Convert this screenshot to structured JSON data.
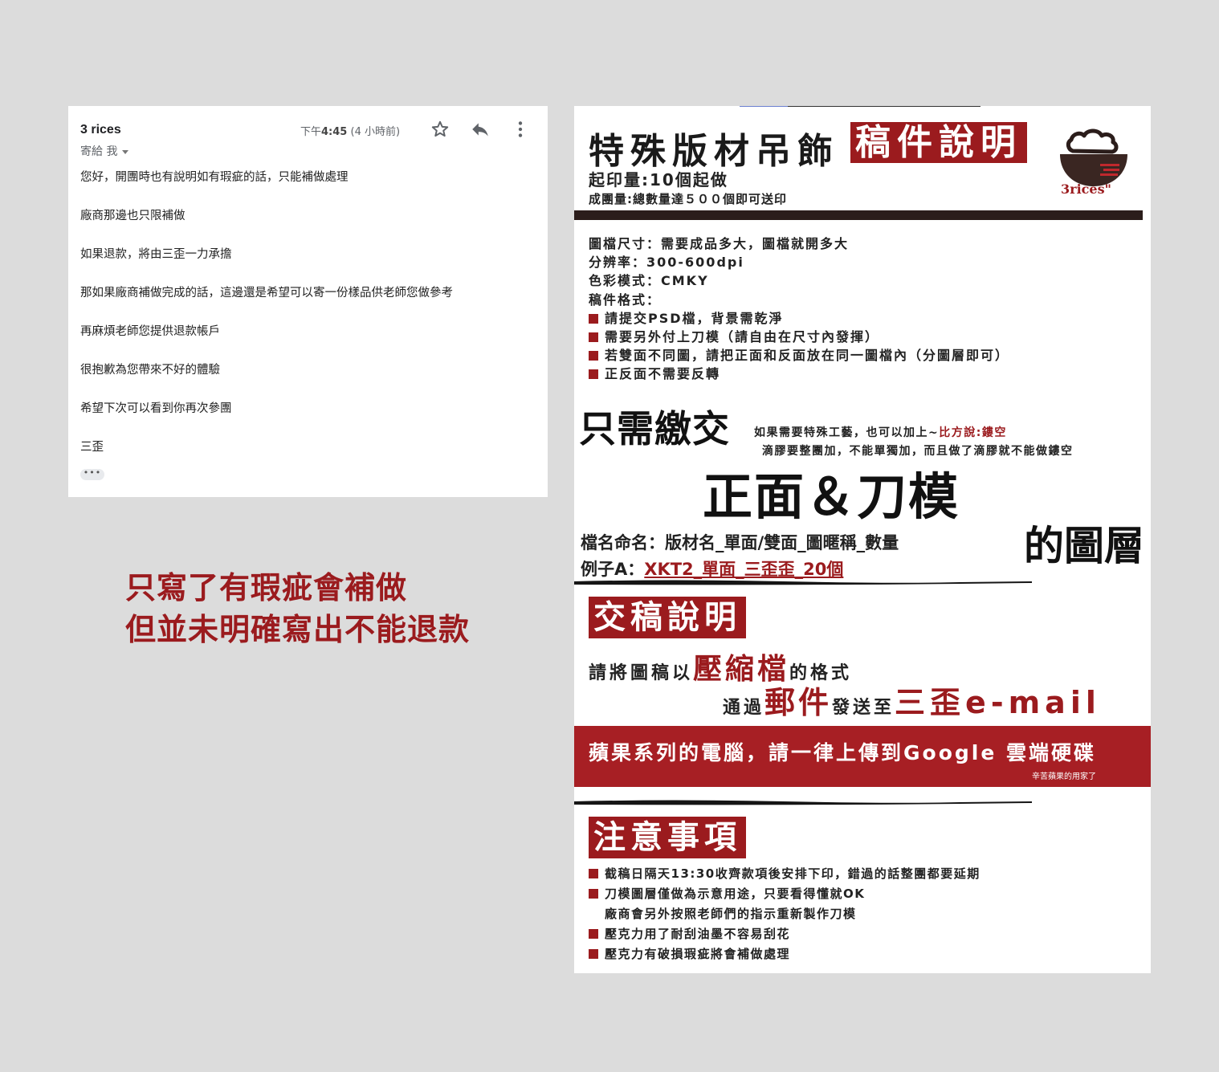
{
  "email": {
    "sender": "3 rices",
    "to": "寄給 我",
    "time_prefix": "下午",
    "time": "4:45",
    "time_suffix": "(4 小時前)",
    "body": [
      "您好，開團時也有說明如有瑕疵的話，只能補做處理",
      "廠商那邊也只限補做",
      "如果退款，將由三歪一力承擔",
      "那如果廠商補做完成的話，這邊還是希望可以寄一份樣品供老師您做參考",
      "再麻煩老師您提供退款帳戶",
      "很抱歉為您帶來不好的體驗",
      "希望下次可以看到你再次參團",
      "三歪"
    ],
    "more": "•••",
    "icons": [
      "star-icon",
      "reply-icon",
      "more-vert-icon"
    ]
  },
  "caption": {
    "line1": "只寫了有瑕疵會補做",
    "line2": "但並未明確寫出不能退款"
  },
  "poster": {
    "title": "特殊版材吊飾",
    "title_red": "稿件說明",
    "min_print": "起印量:10個起做",
    "group_min": "成團量:總數量達５００個即可送印",
    "logo_text": "3rices\"",
    "specs": [
      "圖檔尺寸：需要成品多大，圖檔就開多大",
      "分辨率：300-600dpi",
      "色彩模式：CMKY",
      "稿件格式："
    ],
    "spec_bullets": [
      "請提交PSD檔，背景需乾淨",
      "需要另外付上刀模（請自由在尺寸內發揮）",
      "若雙面不同圖，請把正面和反面放在同一圖檔內（分圖層即可）",
      "正反面不需要反轉"
    ],
    "only_submit": "只需繳交",
    "note1": "如果需要特殊工藝，也可以加上~",
    "note1_red": "比方說:鏤空",
    "note2": "滴膠要整團加，不能單獨加，而且做了滴膠就不能做鏤空",
    "front_knife": "正面＆刀模",
    "layer": "的圖層",
    "naming": "檔名命名：版材名_單面/雙面_圖暱稱_數量",
    "example_prefix": "例子A：",
    "example_red": "XKT2_單面_三歪歪_20個",
    "submit_head": "交稿說明",
    "submit1_a": "請將圖稿以",
    "submit1_big": "壓縮檔",
    "submit1_b": "的格式",
    "submit2_a": "通過",
    "submit2_big": "郵件",
    "submit2_b": "發送至",
    "submit2_email": "三歪e-mail",
    "apple": "蘋果系列的電腦，請一律上傳到Google 雲端硬碟",
    "apple_sub": "辛苦蘋果的用家了",
    "notes_head": "注意事項",
    "notes": [
      {
        "bullet": true,
        "text": "截稿日隔天13:30收齊款項後安排下印，錯過的話整團都要延期"
      },
      {
        "bullet": true,
        "text": "刀模圖層僅做為示意用途，只要看得懂就OK"
      },
      {
        "bullet": false,
        "text": "廠商會另外按照老師們的指示重新製作刀模"
      },
      {
        "bullet": true,
        "text": "壓克力用了耐刮油墨不容易刮花"
      },
      {
        "bullet": true,
        "text": "壓克力有破損瑕疵將會補做處理"
      }
    ],
    "colors": {
      "accent": "#9b1b1e",
      "dark_bar": "#2b1d1b"
    }
  }
}
